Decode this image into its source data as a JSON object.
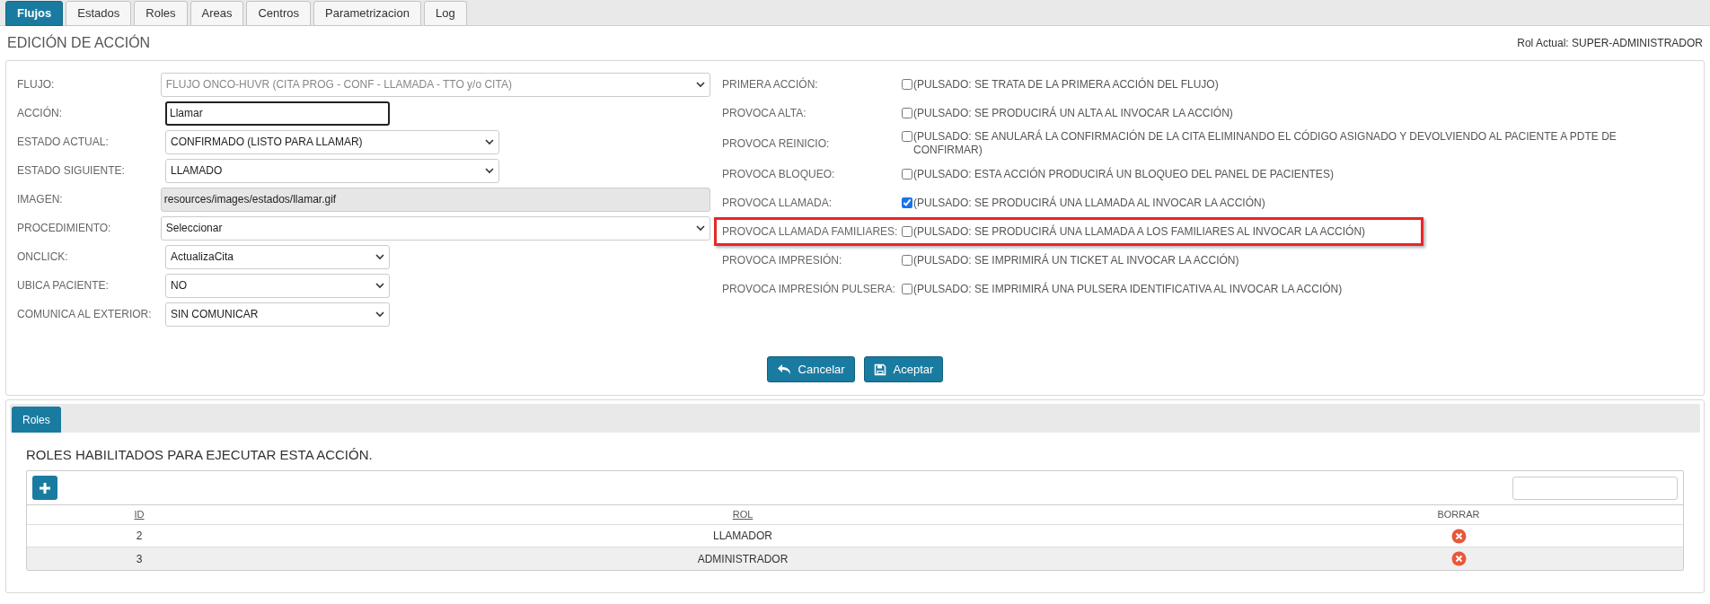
{
  "tabs": [
    {
      "label": "Flujos",
      "selected": true
    },
    {
      "label": "Estados",
      "selected": false
    },
    {
      "label": "Roles",
      "selected": false
    },
    {
      "label": "Areas",
      "selected": false
    },
    {
      "label": "Centros",
      "selected": false
    },
    {
      "label": "Parametrizacion",
      "selected": false
    },
    {
      "label": "Log",
      "selected": false
    }
  ],
  "page_title": "EDICIÓN DE ACCIÓN",
  "current_role": "Rol Actual: SUPER-ADMINISTRADOR",
  "fields": [
    {
      "label": "FLUJO:",
      "kind": "select",
      "value": "FLUJO ONCO-HUVR (CITA PROG - CONF - LLAMADA - TTO y/o CITA)",
      "disabled": true,
      "focused": false,
      "readonly": false
    },
    {
      "label": "ACCIÓN:",
      "kind": "text",
      "value": "Llamar",
      "disabled": false,
      "focused": true,
      "readonly": false
    },
    {
      "label": "ESTADO ACTUAL:",
      "kind": "select",
      "value": "CONFIRMADO (LISTO PARA LLAMAR)",
      "disabled": false,
      "focused": false,
      "readonly": false
    },
    {
      "label": "ESTADO SIGUIENTE:",
      "kind": "select",
      "value": "LLAMADO",
      "disabled": false,
      "focused": false,
      "readonly": false
    },
    {
      "label": "IMAGEN:",
      "kind": "text",
      "value": "resources/images/estados/llamar.gif",
      "disabled": false,
      "focused": false,
      "readonly": true
    },
    {
      "label": "PROCEDIMIENTO:",
      "kind": "select",
      "value": "Seleccionar",
      "disabled": false,
      "focused": false,
      "readonly": false
    },
    {
      "label": "ONCLICK:",
      "kind": "select",
      "value": "ActualizaCita",
      "disabled": false,
      "focused": false,
      "readonly": false
    },
    {
      "label": "UBICA PACIENTE:",
      "kind": "select",
      "value": "NO",
      "disabled": false,
      "focused": false,
      "readonly": false
    },
    {
      "label": "COMUNICA AL EXTERIOR:",
      "kind": "select",
      "value": "SIN COMUNICAR",
      "disabled": false,
      "focused": false,
      "readonly": false
    }
  ],
  "options": [
    {
      "label": "PRIMERA ACCIÓN:",
      "checked": false,
      "description": "(PULSADO: SE TRATA DE LA PRIMERA ACCIÓN DEL FLUJO)",
      "highlighted": false
    },
    {
      "label": "PROVOCA ALTA:",
      "checked": false,
      "description": "(PULSADO: SE PRODUCIRÁ UN ALTA AL INVOCAR LA ACCIÓN)",
      "highlighted": false
    },
    {
      "label": "PROVOCA REINICIO:",
      "checked": false,
      "description": "(PULSADO: SE ANULARÁ LA CONFIRMACIÓN DE LA CITA ELIMINANDO EL CÓDIGO ASIGNADO Y DEVOLVIENDO AL PACIENTE A PDTE DE CONFIRMAR)",
      "highlighted": false
    },
    {
      "label": "PROVOCA BLOQUEO:",
      "checked": false,
      "description": "(PULSADO: ESTA ACCIÓN PRODUCIRÁ UN BLOQUEO DEL PANEL DE PACIENTES)",
      "highlighted": false
    },
    {
      "label": "PROVOCA LLAMADA:",
      "checked": true,
      "description": "(PULSADO: SE PRODUCIRÁ UNA LLAMADA AL INVOCAR LA ACCIÓN)",
      "highlighted": false
    },
    {
      "label": "PROVOCA LLAMADA FAMILIARES:",
      "checked": false,
      "description": "(PULSADO: SE PRODUCIRÁ UNA LLAMADA A LOS FAMILIARES AL INVOCAR LA ACCIÓN)",
      "highlighted": true
    },
    {
      "label": "PROVOCA IMPRESIÓN:",
      "checked": false,
      "description": "(PULSADO: SE IMPRIMIRÁ UN TICKET AL INVOCAR LA ACCIÓN)",
      "highlighted": false
    },
    {
      "label": "PROVOCA IMPRESIÓN PULSERA:",
      "checked": false,
      "description": "(PULSADO: SE IMPRIMIRÁ UNA PULSERA IDENTIFICATIVA AL INVOCAR LA ACCIÓN)",
      "highlighted": false
    }
  ],
  "buttons": [
    {
      "label": "Cancelar",
      "kind": "cancel"
    },
    {
      "label": "Aceptar",
      "kind": "save"
    }
  ],
  "roles_panel": {
    "tabs": [
      {
        "label": "Roles",
        "selected": true
      }
    ],
    "heading": "ROLES HABILITADOS PARA EJECUTAR ESTA ACCIÓN.",
    "table": {
      "columns": [
        "ID",
        "ROL",
        "BORRAR"
      ],
      "rows": [
        {
          "id": "2",
          "rol": "LLAMADOR"
        },
        {
          "id": "3",
          "rol": "ADMINISTRADOR"
        }
      ]
    }
  }
}
